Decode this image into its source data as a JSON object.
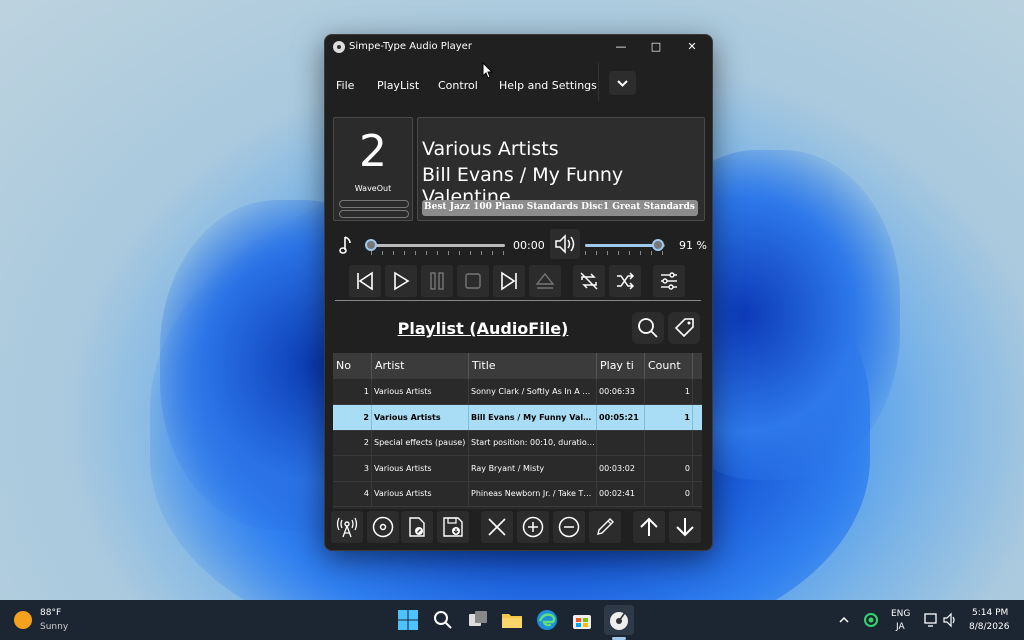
{
  "window": {
    "title": "Simpe-Type Audio Player"
  },
  "menu": [
    "File",
    "PlayList",
    "Control",
    "Help and Settings"
  ],
  "track_number": "2",
  "output_device": "WaveOut",
  "now_playing": {
    "artist": "Various Artists",
    "title": "Bill Evans / My Funny Valentine",
    "album": "Best Jazz 100 Piano Standards Disc1 Great Standards"
  },
  "seek": {
    "time": "00:00",
    "position": 0.0
  },
  "volume": {
    "label": "91 %",
    "level": 0.91
  },
  "playlist": {
    "title": "Playlist (AudioFile)",
    "columns": [
      "No",
      "Artist",
      "Title",
      "Play ti",
      "Count"
    ],
    "rows": [
      {
        "no": "1",
        "artist": "Various Artists",
        "title": "Sonny Clark / Softly As In A M...",
        "time": "00:06:33",
        "count": "1"
      },
      {
        "no": "2",
        "artist": "Various Artists",
        "title": "Bill Evans / My Funny Valent...",
        "time": "00:05:21",
        "count": "1"
      },
      {
        "no": "2",
        "artist": "Special effects (pause)",
        "title": "Start position: 00:10, duration:...",
        "time": "",
        "count": ""
      },
      {
        "no": "3",
        "artist": "Various Artists",
        "title": "Ray Bryant / Misty",
        "time": "00:03:02",
        "count": "0"
      },
      {
        "no": "4",
        "artist": "Various Artists",
        "title": "Phineas Newborn Jr. / Take The...",
        "time": "00:02:41",
        "count": "0"
      }
    ],
    "selected_row": 1
  },
  "taskbar": {
    "weather_temp": "88°F",
    "weather_text": "Sunny",
    "lang_top": "ENG",
    "lang_bottom": "JA",
    "time": "5:14 PM",
    "date": "8/8/2026"
  },
  "colors": {
    "accent": "#9ec9ef",
    "selected_row": "#a8ddf5",
    "window_bg": "#202020"
  }
}
